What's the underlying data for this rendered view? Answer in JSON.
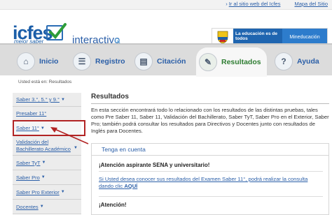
{
  "topbar": {
    "links": [
      "Ir al sitio web del Icfes",
      "Mapa del Sitio"
    ]
  },
  "header": {
    "logo": "icfes",
    "logo_tagline": "mejor saber",
    "product": "interactivo",
    "gov_edu": "La educación es de todos",
    "gov_ministry": "Mineducación"
  },
  "nav": {
    "items": [
      {
        "label": "Inicio",
        "icon": "home-icon"
      },
      {
        "label": "Registro",
        "icon": "form-icon"
      },
      {
        "label": "Citación",
        "icon": "document-icon"
      },
      {
        "label": "Resultados",
        "icon": "results-icon",
        "active": true
      },
      {
        "label": "Ayuda",
        "icon": "help-icon"
      }
    ]
  },
  "breadcrumb": "Usted está en: Resultados",
  "sidebar": {
    "items": [
      {
        "label": "Saber 3.°, 5.° y 9.°",
        "dropdown": true
      },
      {
        "label": "Presaber 11°",
        "dropdown": false
      },
      {
        "label": "Saber 11°",
        "dropdown": true,
        "highlighted": true
      },
      {
        "label": "Validación del Bachillerato Académico",
        "dropdown": true
      },
      {
        "label": "Saber TyT",
        "dropdown": true
      },
      {
        "label": "Saber Pro",
        "dropdown": true
      },
      {
        "label": "Saber Pro Exterior",
        "dropdown": true
      },
      {
        "label": "Docentes",
        "dropdown": true
      }
    ]
  },
  "main": {
    "title": "Resultados",
    "intro": "En esta sección encontrará todo lo relacionado con los resultados de las distintas pruebas, tales como Pre Saber 11, Saber 11, Validación del Bachillerato, Saber TyT, Saber Pro en el Exterior, Saber Pro; también podrá consultar los resultados para Directivos y Docentes junto con resultados de Inglés para Docentes.",
    "box_title": "Tenga en cuenta",
    "notice1_title": "¡Atención aspirante SENA y universitario!",
    "notice1_link": "Si Usted desea conocer sus resultados del Examen Saber 11°, podrá realizar la consulta dando clic ",
    "notice1_link_bold": "AQUÍ",
    "notice2_title": "¡Atención!"
  },
  "colors": {
    "link": "#2b5fa8",
    "active_nav": "#2e7d32",
    "highlight": "#b22424",
    "gov_blue": "#1f65b0"
  }
}
